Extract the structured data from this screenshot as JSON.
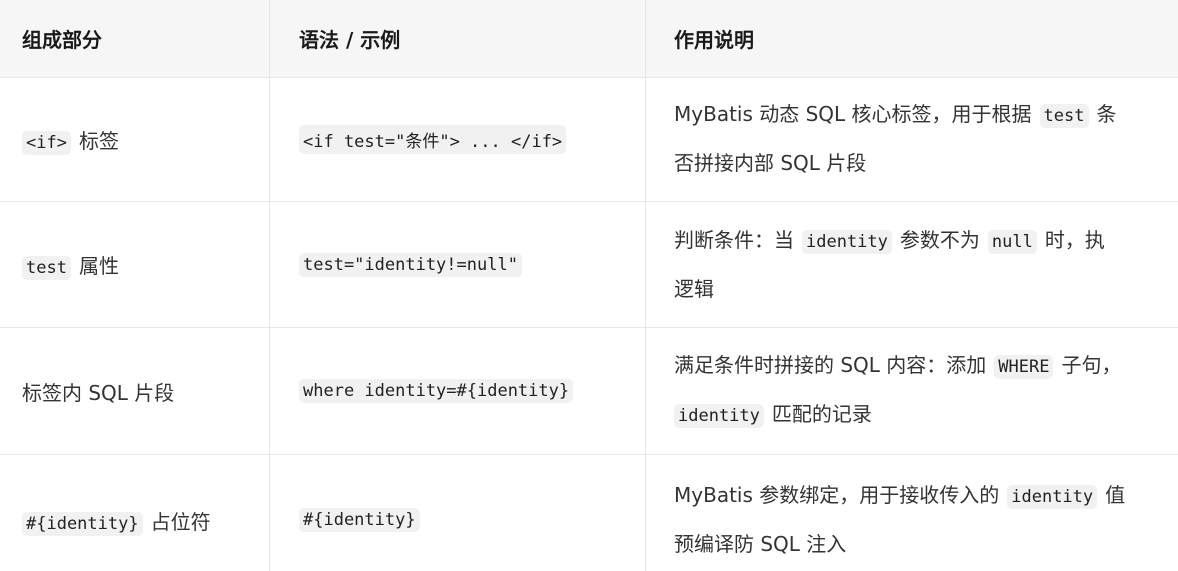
{
  "headers": [
    "组成部分",
    "语法 / 示例",
    "作用说明"
  ],
  "rows": [
    {
      "part_code": "<if>",
      "part_text": "标签",
      "syntax": "<if test=\"条件\"> ... </if>",
      "desc_line1_a": "MyBatis 动态 SQL 核心标签，用于根据",
      "desc_line1_code": "test",
      "desc_line1_b": "条",
      "desc_line2": "否拼接内部 SQL 片段"
    },
    {
      "part_code": "test",
      "part_text": "属性",
      "syntax": "test=\"identity!=null\"",
      "desc_line1_a": "判断条件：当",
      "desc_line1_code": "identity",
      "desc_line1_b": "参数不为",
      "desc_line1_code2": "null",
      "desc_line1_c": "时，执",
      "desc_line2": "逻辑"
    },
    {
      "part_text": "标签内 SQL 片段",
      "syntax": "where identity=#{identity}",
      "desc_line1_a": "满足条件时拼接的 SQL 内容：添加",
      "desc_line1_code": "WHERE",
      "desc_line1_b": "子句，",
      "desc_line2_code": "identity",
      "desc_line2": "匹配的记录"
    },
    {
      "part_code": "#{identity}",
      "part_text": "占位符",
      "syntax": "#{identity}",
      "desc_line1_a": "MyBatis 参数绑定，用于接收传入的",
      "desc_line1_code": "identity",
      "desc_line1_b": "值",
      "desc_line2": "预编译防 SQL 注入"
    }
  ]
}
